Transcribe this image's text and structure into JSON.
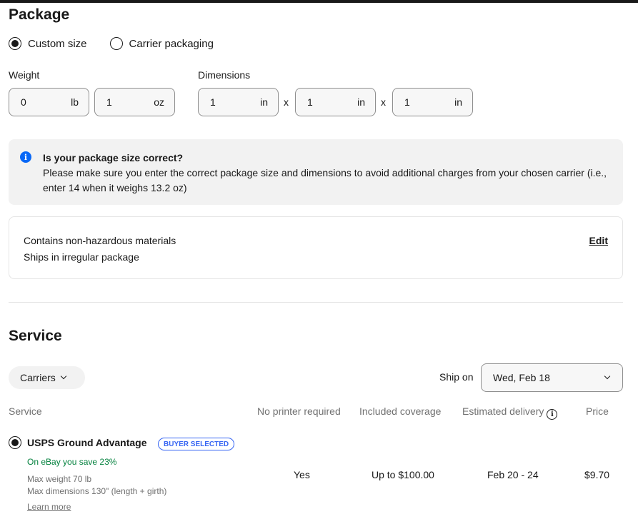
{
  "package": {
    "title": "Package",
    "options": [
      {
        "label": "Custom size",
        "selected": true
      },
      {
        "label": "Carrier packaging",
        "selected": false
      }
    ],
    "weight_label": "Weight",
    "weight": [
      {
        "value": "0",
        "unit": "lb"
      },
      {
        "value": "1",
        "unit": "oz"
      }
    ],
    "dimensions_label": "Dimensions",
    "dimensions": [
      {
        "value": "1",
        "unit": "in"
      },
      {
        "value": "1",
        "unit": "in"
      },
      {
        "value": "1",
        "unit": "in"
      }
    ],
    "separator": "x"
  },
  "notice": {
    "icon": "info-icon",
    "color": "#0968f6",
    "title": "Is your package size correct?",
    "body": "Please make sure you enter the correct package size and dimensions to avoid additional charges from your chosen carrier (i.e., enter 14 when it weighs 13.2 oz)"
  },
  "hazmat": {
    "line1": "Contains non-hazardous materials",
    "line2": "Ships in irregular package",
    "edit_label": "Edit"
  },
  "service": {
    "title": "Service",
    "carriers_label": "Carriers",
    "ship_on_label": "Ship on",
    "ship_on_value": "Wed, Feb 18",
    "columns": [
      "Service",
      "No printer required",
      "Included coverage",
      "Estimated delivery",
      "Price"
    ],
    "rows": [
      {
        "selected": true,
        "name": "USPS Ground Advantage",
        "badge": "BUYER SELECTED",
        "savings": "On eBay you save 23%",
        "max_weight": "Max weight 70 lb",
        "max_dimensions": "Max dimensions 130\" (length + girth)",
        "learn_more": "Learn more",
        "no_printer": "Yes",
        "coverage": "Up to $100.00",
        "delivery": "Feb 20 - 24",
        "price": "$9.70"
      }
    ]
  }
}
